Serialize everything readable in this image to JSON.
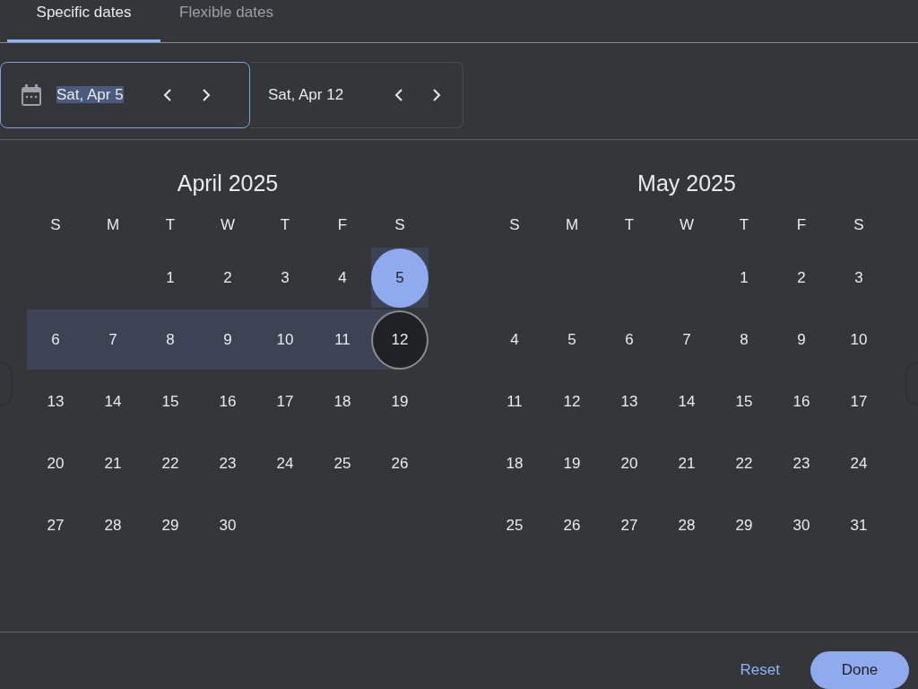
{
  "tabs": [
    {
      "label": "Specific dates",
      "selected": true
    },
    {
      "label": "Flexible dates",
      "selected": false
    }
  ],
  "date_fields": [
    {
      "value": "Sat, Apr 5",
      "focused": true,
      "icon": true,
      "text_selected": true
    },
    {
      "value": "Sat, Apr 12",
      "focused": false,
      "icon": false,
      "text_selected": false
    }
  ],
  "months": [
    {
      "title": "April 2025",
      "weekdays": [
        "S",
        "M",
        "T",
        "W",
        "T",
        "F",
        "S"
      ],
      "weeks": [
        [
          {
            "kind": "blank"
          },
          {
            "kind": "blank"
          },
          {
            "label": "1",
            "kind": "plain"
          },
          {
            "label": "2",
            "kind": "plain"
          },
          {
            "label": "3",
            "kind": "plain"
          },
          {
            "label": "4",
            "kind": "plain"
          },
          {
            "label": "5",
            "kind": "start"
          }
        ],
        [
          {
            "label": "6",
            "kind": "range"
          },
          {
            "label": "7",
            "kind": "range"
          },
          {
            "label": "8",
            "kind": "range"
          },
          {
            "label": "9",
            "kind": "range"
          },
          {
            "label": "10",
            "kind": "range"
          },
          {
            "label": "11",
            "kind": "range"
          },
          {
            "label": "12",
            "kind": "end"
          }
        ],
        [
          {
            "label": "13",
            "kind": "plain"
          },
          {
            "label": "14",
            "kind": "plain"
          },
          {
            "label": "15",
            "kind": "plain"
          },
          {
            "label": "16",
            "kind": "plain"
          },
          {
            "label": "17",
            "kind": "plain"
          },
          {
            "label": "18",
            "kind": "plain"
          },
          {
            "label": "19",
            "kind": "plain"
          }
        ],
        [
          {
            "label": "20",
            "kind": "plain"
          },
          {
            "label": "21",
            "kind": "plain"
          },
          {
            "label": "22",
            "kind": "plain"
          },
          {
            "label": "23",
            "kind": "plain"
          },
          {
            "label": "24",
            "kind": "plain"
          },
          {
            "label": "25",
            "kind": "plain"
          },
          {
            "label": "26",
            "kind": "plain"
          }
        ],
        [
          {
            "label": "27",
            "kind": "plain"
          },
          {
            "label": "28",
            "kind": "plain"
          },
          {
            "label": "29",
            "kind": "plain"
          },
          {
            "label": "30",
            "kind": "plain"
          },
          {
            "kind": "blank"
          },
          {
            "kind": "blank"
          },
          {
            "kind": "blank"
          }
        ]
      ]
    },
    {
      "title": "May 2025",
      "weekdays": [
        "S",
        "M",
        "T",
        "W",
        "T",
        "F",
        "S"
      ],
      "weeks": [
        [
          {
            "kind": "blank"
          },
          {
            "kind": "blank"
          },
          {
            "kind": "blank"
          },
          {
            "kind": "blank"
          },
          {
            "label": "1",
            "kind": "plain"
          },
          {
            "label": "2",
            "kind": "plain"
          },
          {
            "label": "3",
            "kind": "plain"
          }
        ],
        [
          {
            "label": "4",
            "kind": "plain"
          },
          {
            "label": "5",
            "kind": "plain"
          },
          {
            "label": "6",
            "kind": "plain"
          },
          {
            "label": "7",
            "kind": "plain"
          },
          {
            "label": "8",
            "kind": "plain"
          },
          {
            "label": "9",
            "kind": "plain"
          },
          {
            "label": "10",
            "kind": "plain"
          }
        ],
        [
          {
            "label": "11",
            "kind": "plain"
          },
          {
            "label": "12",
            "kind": "plain"
          },
          {
            "label": "13",
            "kind": "plain"
          },
          {
            "label": "14",
            "kind": "plain"
          },
          {
            "label": "15",
            "kind": "plain"
          },
          {
            "label": "16",
            "kind": "plain"
          },
          {
            "label": "17",
            "kind": "plain"
          }
        ],
        [
          {
            "label": "18",
            "kind": "plain"
          },
          {
            "label": "19",
            "kind": "plain"
          },
          {
            "label": "20",
            "kind": "plain"
          },
          {
            "label": "21",
            "kind": "plain"
          },
          {
            "label": "22",
            "kind": "plain"
          },
          {
            "label": "23",
            "kind": "plain"
          },
          {
            "label": "24",
            "kind": "plain"
          }
        ],
        [
          {
            "label": "25",
            "kind": "plain"
          },
          {
            "label": "26",
            "kind": "plain"
          },
          {
            "label": "27",
            "kind": "plain"
          },
          {
            "label": "28",
            "kind": "plain"
          },
          {
            "label": "29",
            "kind": "plain"
          },
          {
            "label": "30",
            "kind": "plain"
          },
          {
            "label": "31",
            "kind": "plain"
          }
        ]
      ]
    }
  ],
  "buttons": [
    {
      "label": "Reset",
      "kind": "text"
    },
    {
      "label": "Done",
      "kind": "filled"
    }
  ]
}
